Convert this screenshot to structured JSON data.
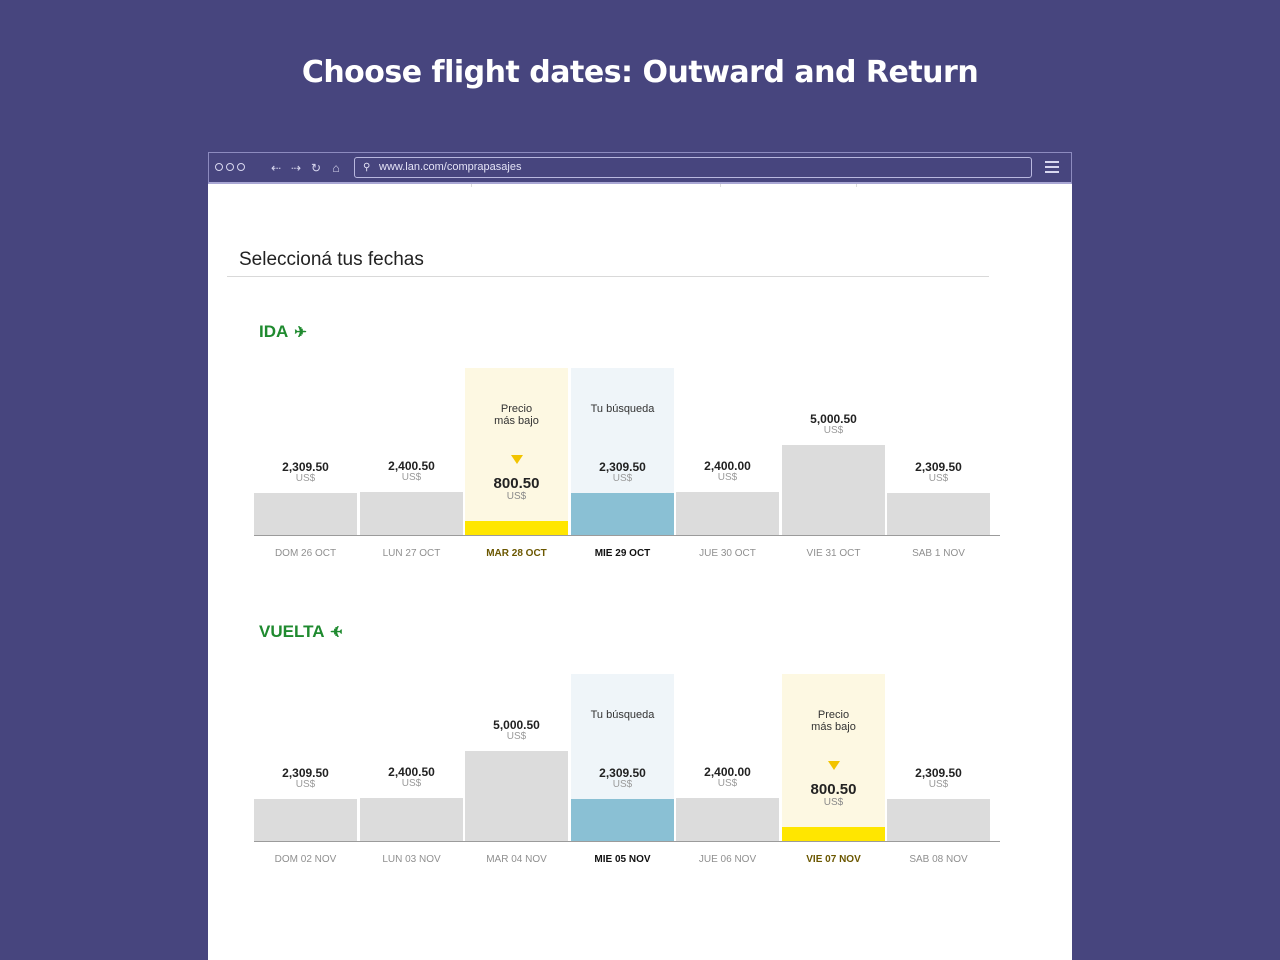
{
  "heading": "Choose flight dates: Outward and Return",
  "browser": {
    "url": "www.lan.com/comprapasajes",
    "icons": [
      "window-dots-icon",
      "back-icon",
      "forward-icon",
      "reload-icon",
      "home-icon",
      "search-icon",
      "menu-icon"
    ]
  },
  "section_title": "Seleccioná tus fechas",
  "colors": {
    "background": "#47457e",
    "leg_green": "#1f8a2f",
    "lowest_bar": "#ffe600",
    "search_bar": "#8ac0d4",
    "bar": "#dcdcdc"
  },
  "legs": [
    {
      "label": "IDA",
      "icon": "plane-right-icon",
      "days": [
        {
          "date": "DOM 26 OCT",
          "price": "2,309.50",
          "currency": "US$",
          "value": 2309.5,
          "type": "normal"
        },
        {
          "date": "LUN 27 OCT",
          "price": "2,400.50",
          "currency": "US$",
          "value": 2400.5,
          "type": "normal"
        },
        {
          "date": "MAR 28 OCT",
          "price": "800.50",
          "currency": "US$",
          "value": 800.5,
          "type": "lowest",
          "caption": "Precio\nmás bajo"
        },
        {
          "date": "MIE 29 OCT",
          "price": "2,309.50",
          "currency": "US$",
          "value": 2309.5,
          "type": "search",
          "caption": "Tu búsqueda"
        },
        {
          "date": "JUE 30 OCT",
          "price": "2,400.00",
          "currency": "US$",
          "value": 2400.0,
          "type": "normal"
        },
        {
          "date": "VIE 31 OCT",
          "price": "5,000.50",
          "currency": "US$",
          "value": 5000.5,
          "type": "normal"
        },
        {
          "date": "SAB 1 NOV",
          "price": "2,309.50",
          "currency": "US$",
          "value": 2309.5,
          "type": "normal"
        }
      ]
    },
    {
      "label": "VUELTA",
      "icon": "plane-left-icon",
      "days": [
        {
          "date": "DOM 02 NOV",
          "price": "2,309.50",
          "currency": "US$",
          "value": 2309.5,
          "type": "normal"
        },
        {
          "date": "LUN 03 NOV",
          "price": "2,400.50",
          "currency": "US$",
          "value": 2400.5,
          "type": "normal"
        },
        {
          "date": "MAR 04 NOV",
          "price": "5,000.50",
          "currency": "US$",
          "value": 5000.5,
          "type": "normal"
        },
        {
          "date": "MIE 05 NOV",
          "price": "2,309.50",
          "currency": "US$",
          "value": 2309.5,
          "type": "search",
          "caption": "Tu búsqueda"
        },
        {
          "date": "JUE 06 NOV",
          "price": "2,400.00",
          "currency": "US$",
          "value": 2400.0,
          "type": "normal"
        },
        {
          "date": "VIE 07 NOV",
          "price": "800.50",
          "currency": "US$",
          "value": 800.5,
          "type": "lowest",
          "caption": "Precio\nmás bajo"
        },
        {
          "date": "SAB 08 NOV",
          "price": "2,309.50",
          "currency": "US$",
          "value": 2309.5,
          "type": "normal"
        }
      ]
    }
  ]
}
